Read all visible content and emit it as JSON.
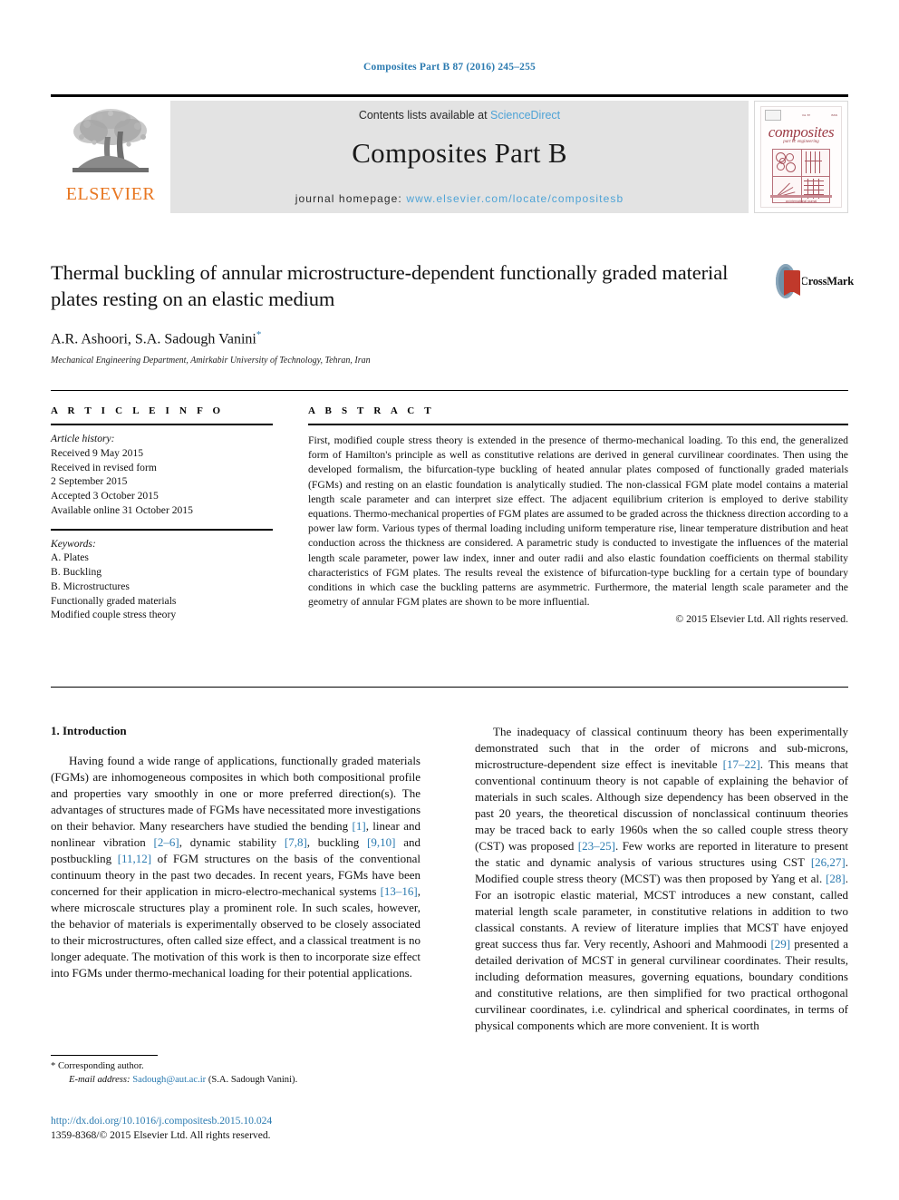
{
  "running_head": "Composites Part B 87 (2016) 245–255",
  "masthead": {
    "publisher_name": "ELSEVIER",
    "contents_prefix": "Contents lists available at ",
    "contents_link": "ScienceDirect",
    "journal_title": "Composites Part B",
    "homepage_prefix": "journal homepage: ",
    "homepage_url": "www.elsevier.com/locate/compositesb",
    "cover": {
      "word": "composites",
      "subtitle": "part B: engineering",
      "footer": "an international journal"
    }
  },
  "article": {
    "title": "Thermal buckling of annular microstructure-dependent functionally graded material plates resting on an elastic medium",
    "authors": "A.R. Ashoori, S.A. Sadough Vanini",
    "corresponding_marker": "*",
    "affiliation": "Mechanical Engineering Department, Amirkabir University of Technology, Tehran, Iran",
    "crossmark_label": "CrossMark"
  },
  "info": {
    "heading": "A R T I C L E   I N F O",
    "history_label": "Article history:",
    "history": [
      "Received 9 May 2015",
      "Received in revised form",
      "2 September 2015",
      "Accepted 3 October 2015",
      "Available online 31 October 2015"
    ],
    "keywords_label": "Keywords:",
    "keywords": [
      "A. Plates",
      "B. Buckling",
      "B. Microstructures",
      "Functionally graded materials",
      "Modified couple stress theory"
    ]
  },
  "abstract": {
    "heading": "A B S T R A C T",
    "text": "First, modified couple stress theory is extended in the presence of thermo-mechanical loading. To this end, the generalized form of Hamilton's principle as well as constitutive relations are derived in general curvilinear coordinates. Then using the developed formalism, the bifurcation-type buckling of heated annular plates composed of functionally graded materials (FGMs) and resting on an elastic foundation is analytically studied. The non-classical FGM plate model contains a material length scale parameter and can interpret size effect. The adjacent equilibrium criterion is employed to derive stability equations. Thermo-mechanical properties of FGM plates are assumed to be graded across the thickness direction according to a power law form. Various types of thermal loading including uniform temperature rise, linear temperature distribution and heat conduction across the thickness are considered. A parametric study is conducted to investigate the influences of the material length scale parameter, power law index, inner and outer radii and also elastic foundation coefficients on thermal stability characteristics of FGM plates. The results reveal the existence of bifurcation-type buckling for a certain type of boundary conditions in which case the buckling patterns are asymmetric. Furthermore, the material length scale parameter and the geometry of annular FGM plates are shown to be more influential.",
    "copyright": "© 2015 Elsevier Ltd. All rights reserved."
  },
  "body": {
    "section_heading": "1. Introduction",
    "left_para_1": "Having found a wide range of applications, functionally graded materials (FGMs) are inhomogeneous composites in which both compositional profile and properties vary smoothly in one or more preferred direction(s). The advantages of structures made of FGMs have necessitated more investigations on their behavior. Many researchers have studied the bending ",
    "left_para_1b": ", linear and nonlinear vibration ",
    "left_para_1c": ", dynamic stability ",
    "left_para_1d": ", buckling ",
    "left_para_1e": " and postbuckling ",
    "left_para_1f": " of FGM structures on the basis of the conventional continuum theory in the past two decades. In recent years, FGMs have been concerned for their application in micro-electro-mechanical systems ",
    "left_para_1g": ", where microscale structures play a prominent role. In such scales, however, the behavior of materials is experimentally observed to be closely associated to their microstructures, often called size effect, and a classical treatment is no longer adequate. The motivation of this work is then to incorporate size effect into FGMs under thermo-mechanical loading for their potential applications.",
    "right_para_1": "The inadequacy of classical continuum theory has been experimentally demonstrated such that in the order of microns and sub-microns, microstructure-dependent size effect is inevitable ",
    "right_para_1b": ". This means that conventional continuum theory is not capable of explaining the behavior of materials in such scales. Although size dependency has been observed in the past 20 years, the theoretical discussion of nonclassical continuum theories may be traced back to early 1960s when the so called couple stress theory (CST) was proposed ",
    "right_para_1c": ". Few works are reported in literature to present the static and dynamic analysis of various structures using CST ",
    "right_para_1d": ". Modified couple stress theory (MCST) was then proposed by Yang et al. ",
    "right_para_1e": ". For an isotropic elastic material, MCST introduces a new constant, called material length scale parameter, in constitutive relations in addition to two classical constants. A review of literature implies that MCST have enjoyed great success thus far. Very recently, Ashoori and Mahmoodi ",
    "right_para_1f": " presented a detailed derivation of MCST in general curvilinear coordinates. Their results, including deformation measures, governing equations, boundary conditions and constitutive relations, are then simplified for two practical orthogonal curvilinear coordinates, i.e. cylindrical and spherical coordinates, in terms of physical components which are more convenient. It is worth",
    "refs": {
      "r1": "[1]",
      "r2": "[2–6]",
      "r3": "[7,8]",
      "r4": "[9,10]",
      "r5": "[11,12]",
      "r6": "[13–16]",
      "r7": "[17–22]",
      "r8": "[23–25]",
      "r9": "[26,27]",
      "r10": "[28]",
      "r11": "[29]"
    }
  },
  "footnote": {
    "corresponding": "* Corresponding author.",
    "email_label": "E-mail address:",
    "email": "Sadough@aut.ac.ir",
    "email_owner": "(S.A. Sadough Vanini)."
  },
  "footer": {
    "doi": "http://dx.doi.org/10.1016/j.compositesb.2015.10.024",
    "issn": "1359-8368/© 2015 Elsevier Ltd. All rights reserved."
  },
  "colors": {
    "link": "#2a7ab0",
    "sciencedirect": "#4ea3d6",
    "elsevier_orange": "#e87722",
    "cover_red": "#9c3b45",
    "masthead_bg": "#e3e3e3"
  }
}
